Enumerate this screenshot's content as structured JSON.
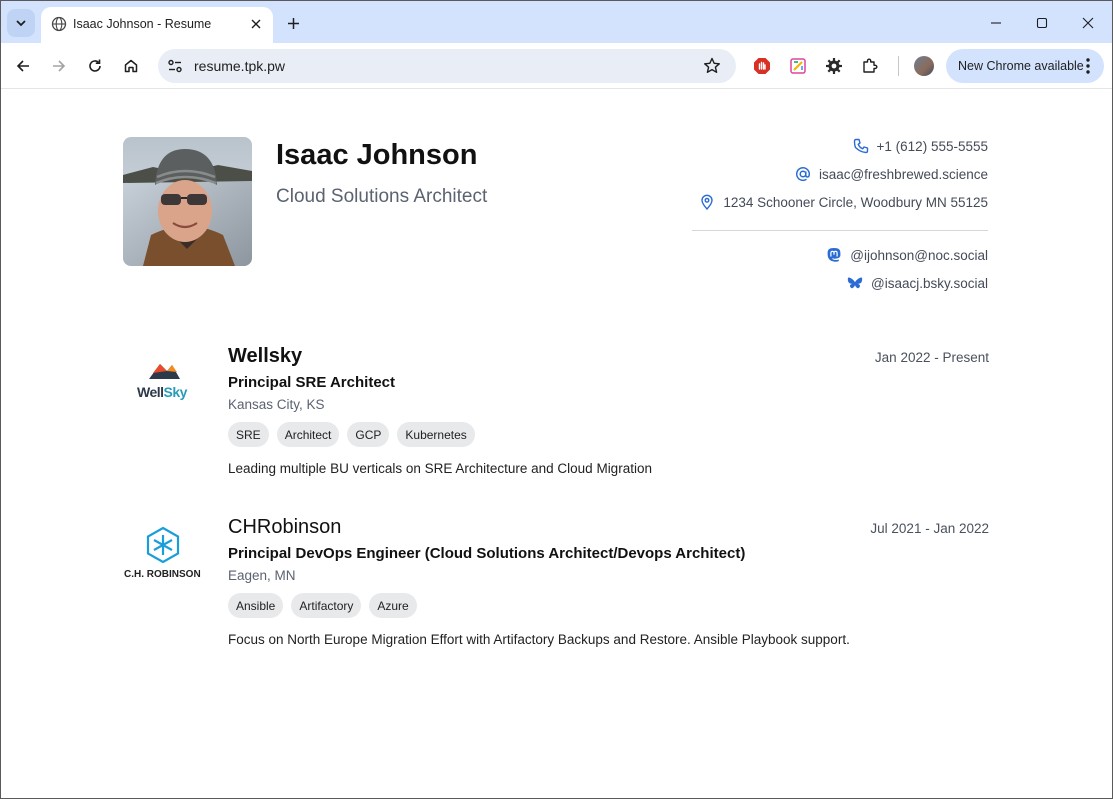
{
  "browser": {
    "tab_title": "Isaac Johnson - Resume",
    "url": "resume.tpk.pw",
    "update_label": "New Chrome available"
  },
  "resume": {
    "name": "Isaac Johnson",
    "title": "Cloud Solutions Architect",
    "contact": {
      "phone": "+1 (612) 555-5555",
      "email": "isaac@freshbrewed.science",
      "address": "1234 Schooner Circle, Woodbury MN 55125",
      "mastodon": "@ijohnson@noc.social",
      "bluesky": "@isaacj.bsky.social"
    },
    "jobs": [
      {
        "company": "Wellsky",
        "logo_text": "WellSky",
        "title": "Principal SRE Architect",
        "location": "Kansas City, KS",
        "dates": "Jan 2022 - Present",
        "tags": [
          "SRE",
          "Architect",
          "GCP",
          "Kubernetes"
        ],
        "description": "Leading multiple BU verticals on SRE Architecture and Cloud Migration"
      },
      {
        "company": "CHRobinson",
        "logo_text": "C.H. ROBINSON",
        "title": "Principal DevOps Engineer (Cloud Solutions Architect/Devops Architect)",
        "location": "Eagen, MN",
        "dates": "Jul 2021 - Jan 2022",
        "tags": [
          "Ansible",
          "Artifactory",
          "Azure"
        ],
        "description": "Focus on North Europe Migration Effort with Artifactory Backups and Restore. Ansible Playbook support."
      }
    ]
  },
  "colors": {
    "accent": "#2b6cd4",
    "tabstrip": "#d3e3fd",
    "tag_bg": "#e8e9eb",
    "chrobinson_logo": "#1a9ed9"
  }
}
